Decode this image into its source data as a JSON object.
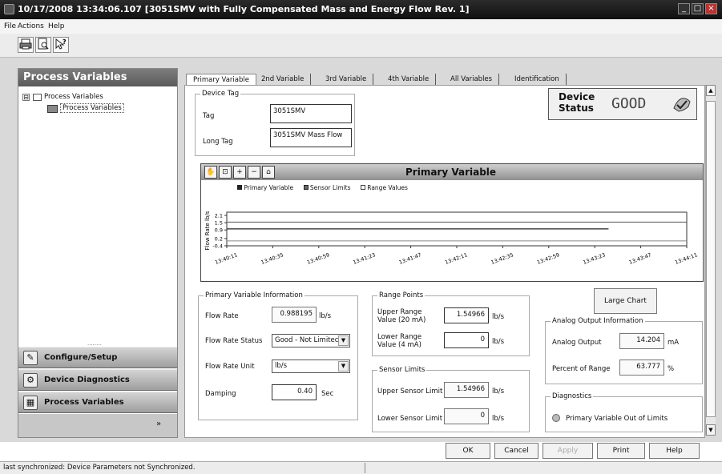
{
  "window": {
    "title": "10/17/2008 13:34:06.107 [3051SMV with Fully Compensated Mass and Energy Flow Rev. 1]",
    "controls": [
      "_",
      "□",
      "×"
    ]
  },
  "menu": [
    "File",
    "Actions",
    "Help"
  ],
  "toolbar": {
    "print_icon": "printer-icon",
    "preview_icon": "print-preview-icon",
    "help_icon": "whats-this-help-icon"
  },
  "left_pane": {
    "header": "Process Variables",
    "tree": [
      {
        "label": "Process Variables",
        "expander": "⊟"
      },
      {
        "label": "Process Variables"
      }
    ],
    "nav": [
      {
        "label": "Configure/Setup",
        "icon": "wrench-icon"
      },
      {
        "label": "Device Diagnostics",
        "icon": "diagnostics-icon"
      },
      {
        "label": "Process Variables",
        "icon": "process-variables-icon"
      }
    ],
    "grip": "........"
  },
  "tabs": [
    "Primary Variable",
    "2nd Variable",
    "3rd Variable",
    "4th Variable",
    "All Variables",
    "Identification"
  ],
  "device_tag": {
    "group_label": "Device Tag",
    "tag_label": "Tag",
    "tag_value": "3051SMV",
    "long_tag_label": "Long Tag",
    "long_tag_value": "3051SMV Mass Flow"
  },
  "device_status": {
    "label_line1": "Device",
    "label_line2": "Status",
    "value": "GOOD"
  },
  "chart": {
    "title": "Primary Variable",
    "toolbar_icons": [
      "pan-hand-icon",
      "zoom-box-icon",
      "zoom-in-icon",
      "zoom-out-icon",
      "reset-home-icon"
    ],
    "legend": [
      "Primary Variable",
      "Sensor Limits",
      "Range Values"
    ],
    "colors": {
      "primary": "#222222",
      "sensor": "#555555",
      "range": "#888888"
    }
  },
  "chart_data": {
    "type": "line",
    "title": "Primary Variable",
    "ylabel": "Flow Rate lb/s",
    "xlabel": "",
    "yticks": [
      "2.1",
      "1.5",
      "0.9",
      "0.2",
      "-0.4"
    ],
    "ylim": [
      -0.4,
      2.1
    ],
    "x_ticks": [
      "13:40:11",
      "13:40:35",
      "13:40:59",
      "13:41:23",
      "13:41:47",
      "13:42:11",
      "13:42:35",
      "13:42:59",
      "13:43:23",
      "13:43:47",
      "13:44:11"
    ],
    "series": [
      {
        "name": "Primary Variable",
        "values": [
          0.988,
          0.988,
          0.988,
          0.988,
          0.988,
          0.988,
          0.988,
          0.988,
          0.988
        ],
        "x_end_index": 8.3
      },
      {
        "name": "Sensor Limits",
        "values": [
          1.55,
          1.55,
          1.55,
          1.55,
          1.55,
          1.55,
          1.55,
          1.55,
          1.55,
          1.55,
          1.55
        ]
      },
      {
        "name": "Range Values",
        "values": [
          0.0,
          0.0,
          0.0,
          0.0,
          0.0,
          0.0,
          0.0,
          0.0,
          0.0,
          0.0,
          0.0
        ]
      }
    ],
    "legend_position": "top"
  },
  "pv_info": {
    "group_label": "Primary Variable Information",
    "flow_rate_label": "Flow Rate",
    "flow_rate_value": "0.988195",
    "flow_rate_unit": "lb/s",
    "status_label": "Flow Rate Status",
    "status_value": "Good - Not Limitec",
    "unit_label": "Flow Rate Unit",
    "unit_value": "lb/s",
    "damping_label": "Damping",
    "damping_value": "0.40",
    "damping_unit": "Sec"
  },
  "range_points": {
    "group_label": "Range Points",
    "upper_label_1": "Upper Range",
    "upper_label_2": "Value (20 mA)",
    "upper_value": "1.54966",
    "upper_unit": "lb/s",
    "lower_label_1": "Lower Range",
    "lower_label_2": "Value (4 mA)",
    "lower_value": "0",
    "lower_unit": "lb/s"
  },
  "sensor_limits": {
    "group_label": "Sensor Limits",
    "upper_label": "Upper Sensor Limit",
    "upper_value": "1.54966",
    "upper_unit": "lb/s",
    "lower_label": "Lower Sensor Limit",
    "lower_value": "0",
    "lower_unit": "lb/s"
  },
  "large_chart_button": "Large Chart",
  "analog_output": {
    "group_label": "Analog Output Information",
    "output_label": "Analog Output",
    "output_value": "14.204",
    "output_unit": "mA",
    "percent_label": "Percent of Range",
    "percent_value": "63.777",
    "percent_unit": "%"
  },
  "diagnostics": {
    "group_label": "Diagnostics",
    "item": "Primary Variable Out of Limits"
  },
  "buttons": {
    "ok": "OK",
    "cancel": "Cancel",
    "apply": "Apply",
    "print": "Print",
    "help": "Help"
  },
  "statusbar": {
    "text": "last synchronized: Device Parameters not Synchronized."
  }
}
